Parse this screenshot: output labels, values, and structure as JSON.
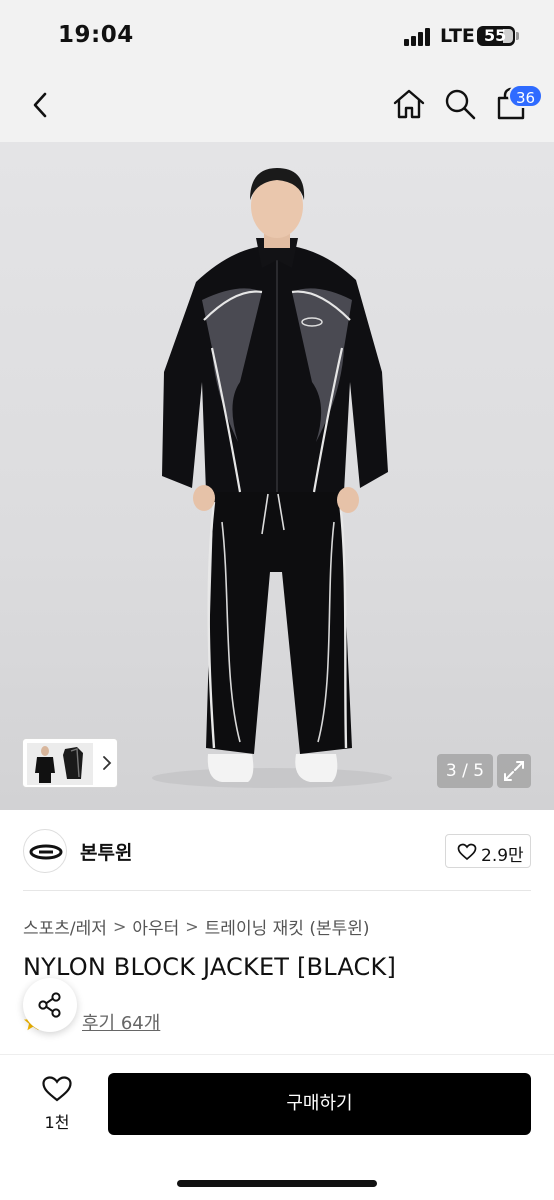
{
  "status": {
    "time": "19:04",
    "network": "LTE",
    "battery": "55"
  },
  "header": {
    "back_icon": "chevron-left-icon",
    "home_icon": "home-icon",
    "search_icon": "search-icon",
    "cart_icon": "shopping-bag-icon",
    "cart_badge": "36",
    "badge_color": "#2f6bff"
  },
  "gallery": {
    "indicator": "3 / 5",
    "expand_icon": "expand-icon"
  },
  "brand": {
    "name": "본투윈",
    "likes": "2.9만",
    "heart_icon": "heart-outline-icon"
  },
  "product": {
    "breadcrumb": [
      "스포츠/레저",
      "아우터",
      "트레이닝 재킷 (본투윈)"
    ],
    "breadcrumb_sep": ">",
    "title": "NYLON BLOCK JACKET [BLACK]",
    "rating": "",
    "review_link": "후기 64개",
    "share_icon": "share-icon"
  },
  "bottom_bar": {
    "wish_count": "1천",
    "buy_label": "구매하기"
  }
}
